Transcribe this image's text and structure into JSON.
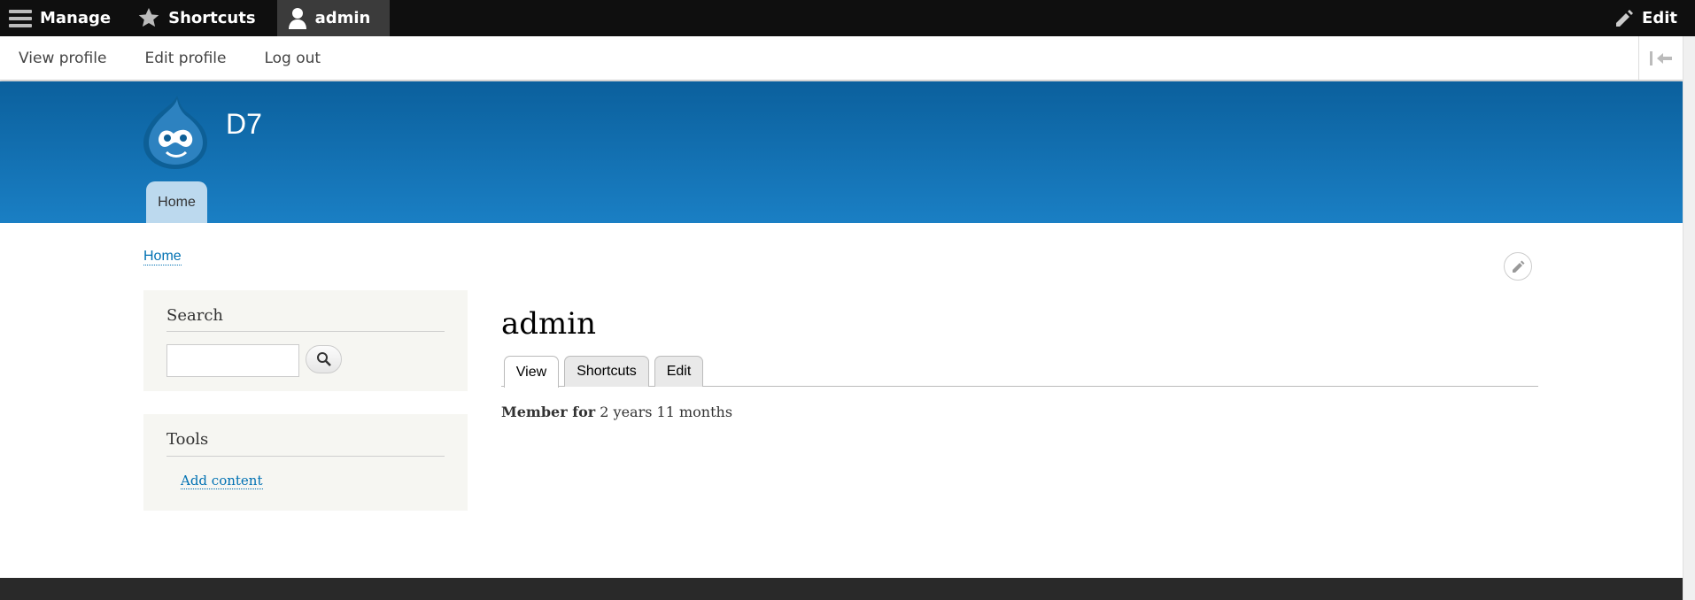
{
  "toolbar": {
    "manage": "Manage",
    "shortcuts": "Shortcuts",
    "user": "admin",
    "edit": "Edit"
  },
  "tray": {
    "view_profile": "View profile",
    "edit_profile": "Edit profile",
    "log_out": "Log out"
  },
  "header": {
    "site_name": "D7",
    "nav_home": "Home"
  },
  "breadcrumb": {
    "home": "Home"
  },
  "sidebar": {
    "search_title": "Search",
    "tools_title": "Tools",
    "tools_link": "Add content"
  },
  "main": {
    "title": "admin",
    "tabs": [
      {
        "label": "View"
      },
      {
        "label": "Shortcuts"
      },
      {
        "label": "Edit"
      }
    ],
    "member_label": "Member for",
    "member_value": "2 years 11 months"
  },
  "colors": {
    "toolbar_bg": "#0f0f0f",
    "header_top": "#0b609d",
    "header_bottom": "#1a7fc4",
    "link": "#0071b3",
    "sidebar_bg": "#f6f6f2"
  }
}
